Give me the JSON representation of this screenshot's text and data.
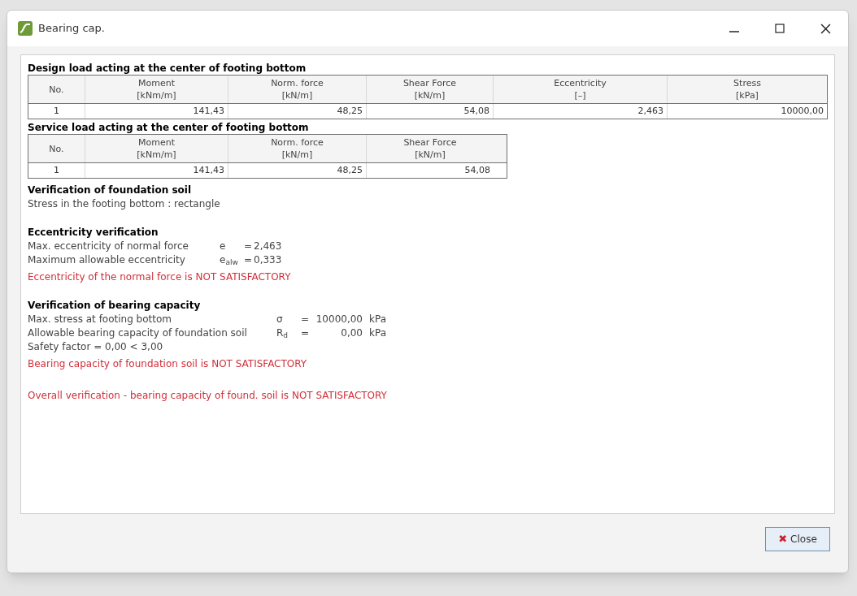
{
  "window": {
    "title": "Bearing cap."
  },
  "tables": [
    {
      "title": "Design load acting at the center of footing bottom",
      "columns": [
        {
          "name": "No."
        },
        {
          "name": "Moment",
          "unit": "[kNm/m]"
        },
        {
          "name": "Norm. force",
          "unit": "[kN/m]"
        },
        {
          "name": "Shear Force",
          "unit": "[kN/m]"
        },
        {
          "name": "Eccentricity",
          "unit": "[–]"
        },
        {
          "name": "Stress",
          "unit": "[kPa]"
        }
      ],
      "rows": [
        [
          "1",
          "141,43",
          "48,25",
          "54,08",
          "2,463",
          "10000,00"
        ]
      ]
    },
    {
      "title": "Service load acting at the center of footing bottom",
      "columns": [
        {
          "name": "No."
        },
        {
          "name": "Moment",
          "unit": "[kNm/m]"
        },
        {
          "name": "Norm. force",
          "unit": "[kN/m]"
        },
        {
          "name": "Shear Force",
          "unit": "[kN/m]"
        }
      ],
      "rows": [
        [
          "1",
          "141,43",
          "48,25",
          "54,08"
        ]
      ]
    }
  ],
  "sections": [
    {
      "heading": "Verification of foundation soil",
      "lines": [
        {
          "kind": "text",
          "text": "Stress in the footing bottom : rectangle"
        }
      ]
    },
    {
      "heading": "Eccentricity verification",
      "lines": [
        {
          "kind": "value",
          "label": "Max. eccentricity of normal force",
          "symbol": "e",
          "eq": "=",
          "value": "2,463"
        },
        {
          "kind": "value",
          "label": "Maximum allowable eccentricity",
          "symbol": "e$_{alw}$",
          "eq": "=",
          "value": "0,333"
        },
        {
          "kind": "error",
          "text": "Eccentricity of the normal force is NOT SATISFACTORY"
        }
      ]
    },
    {
      "heading": "Verification of bearing capacity",
      "lines": [
        {
          "kind": "value2",
          "label": "Max. stress at footing bottom",
          "symbol": "σ",
          "eq": "=",
          "value": "10000,00",
          "unit": "kPa"
        },
        {
          "kind": "value2",
          "label": "Allowable bearing capacity of foundation soil",
          "symbol": "R$_{d}$",
          "eq": "=",
          "value": "0,00",
          "unit": "kPa"
        },
        {
          "kind": "text",
          "text": "Safety factor = 0,00 < 3,00"
        },
        {
          "kind": "error",
          "text": "Bearing capacity of foundation soil is NOT SATISFACTORY"
        }
      ]
    },
    {
      "lines": [
        {
          "kind": "error",
          "text": "Overall verification - bearing capacity of found. soil is NOT SATISFACTORY"
        }
      ]
    }
  ],
  "close_button": {
    "icon": "✖",
    "label": "Close"
  }
}
